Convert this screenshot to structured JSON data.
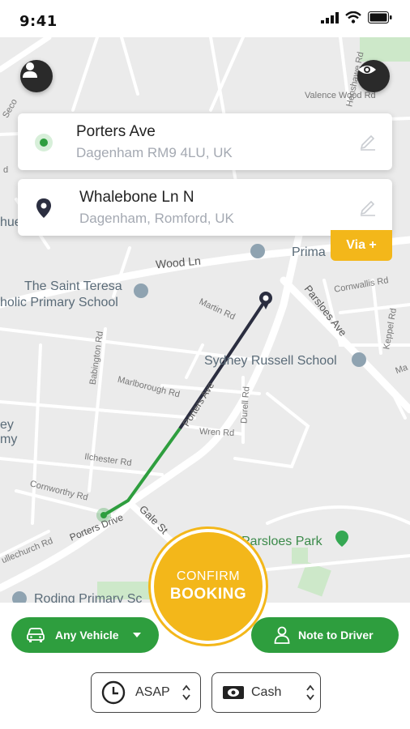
{
  "status_bar": {
    "time": "9:41"
  },
  "map": {
    "labels": {
      "school1_line1": "The Saint Teresa",
      "school1_line2": "holic Primary School",
      "sydney": "Sydney Russell School",
      "parsloes_park": "Parsloes Park",
      "roding": "Roding Primary Sc",
      "primary": "Prima",
      "wood_ln": "Wood Ln",
      "parsloes_ave": "Parsloes Ave",
      "martin_rd": "Martin Rd",
      "marlborough_rd": "Marlborough Rd",
      "babington_rd": "Babington Rd",
      "durell_rd": "Durell Rd",
      "wren_rd": "Wren Rd",
      "ilchester_rd": "Ilchester Rd",
      "cornworthy_rd": "Cornworthy Rd",
      "gale_st": "Gale St",
      "porters_ave": "Porters Ave",
      "porters_dr": "Porters Drive",
      "cornwallis_rd": "Cornwallis Rd",
      "keppel_rd": "Keppel Rd",
      "valence_wood": "Valence Wood Rd",
      "henshawe": "Henshawe Rd",
      "left_ey": "ey",
      "left_my": "my",
      "left_hue": "hue",
      "left_seco": "Seco",
      "left_d": "d",
      "ulle": "ullechurch Rd",
      "ma": "Ma"
    }
  },
  "pickup": {
    "title": "Porters Ave",
    "subtitle": "Dagenham RM9 4LU, UK"
  },
  "dropoff": {
    "title": "Whalebone Ln N",
    "subtitle": "Dagenham, Romford, UK"
  },
  "via_label": "Via +",
  "confirm": {
    "line1": "CONFIRM",
    "line2": "BOOKING"
  },
  "vehicle_button": {
    "label": "Any Vehicle"
  },
  "note_button": {
    "label": "Note to Driver"
  },
  "time_selector": {
    "value": "ASAP"
  },
  "payment_selector": {
    "value": "Cash"
  },
  "colors": {
    "accent": "#f3b71a",
    "green": "#2e9e3e",
    "route_dark": "#2b2e40"
  }
}
